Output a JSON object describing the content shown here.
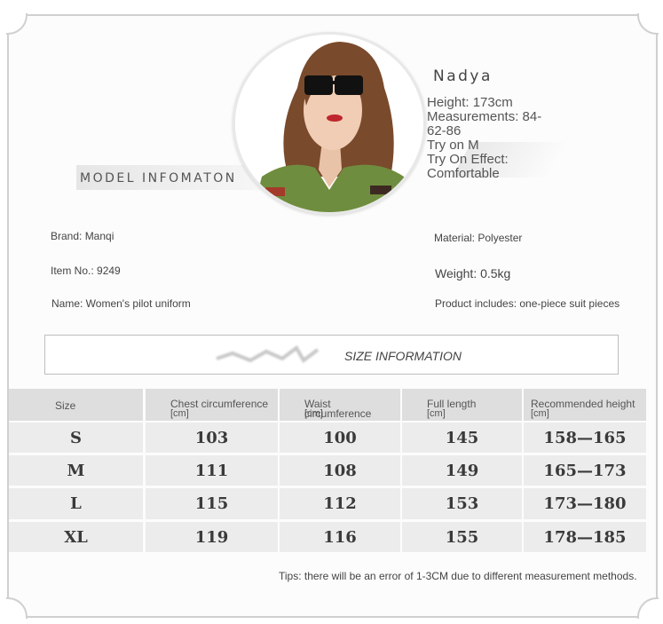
{
  "model": {
    "section_label": "MODEL INFOMATON",
    "name": "Nadya",
    "height": "Height: 173cm",
    "measurements": "Measurements: 84-62-86",
    "try_on": "Try on M",
    "try_on_effect": "Try On Effect: Comfortable"
  },
  "product": {
    "brand": "Brand: Manqi",
    "item_no": "Item No.: 9249",
    "name": "Name: Women's pilot uniform",
    "material": "Material: Polyester",
    "weight": "Weight: 0.5kg",
    "includes": "Product includes: one-piece suit pieces"
  },
  "size_info": {
    "title": "SIZE INFORMATION",
    "headers": [
      {
        "label": "Size",
        "unit": ""
      },
      {
        "label": "Chest circumference",
        "unit": "[cm]"
      },
      {
        "label": "Waist circumference",
        "unit": "[cm]"
      },
      {
        "label": "Full length",
        "unit": "[cm]"
      },
      {
        "label": "Recommended height",
        "unit": "[cm]"
      }
    ],
    "rows": [
      [
        "S",
        "103",
        "100",
        "145",
        "158—165"
      ],
      [
        "M",
        "111",
        "108",
        "149",
        "165—173"
      ],
      [
        "L",
        "115",
        "112",
        "153",
        "173—180"
      ],
      [
        "XL",
        "119",
        "116",
        "155",
        "178—185"
      ]
    ]
  },
  "tips": "Tips: there will be an error of 1-3CM due to different measurement methods."
}
